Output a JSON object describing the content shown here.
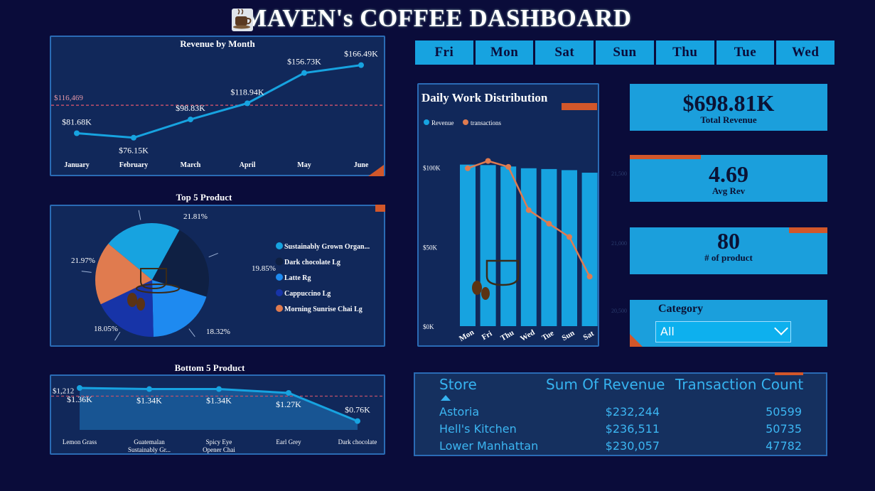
{
  "header": {
    "title": "MAVEN's COFFEE DASHBOARD"
  },
  "colors": {
    "background": "#0a0c3a",
    "panel": "#11285a",
    "accent_blue": "#17a3e0",
    "accent_orange": "#e07b4f",
    "pie_dark": "#0f2043",
    "pie_blue2": "#1e8af0",
    "pie_blue3": "#1734a8"
  },
  "day_buttons": [
    "Fri",
    "Mon",
    "Sat",
    "Sun",
    "Thu",
    "Tue",
    "Wed"
  ],
  "kpis": {
    "total_revenue": {
      "value": "$698.81K",
      "label": "Total Revenue"
    },
    "avg_rev": {
      "value": "4.69",
      "label": "Avg Rev"
    },
    "num_product": {
      "value": "80",
      "label": "# of product"
    }
  },
  "category_filter": {
    "label": "Category",
    "selected": "All"
  },
  "table": {
    "headers": [
      "Store",
      "Sum Of Revenue",
      "Transaction Count"
    ],
    "rows": [
      [
        "Astoria",
        "$232,244",
        "50599"
      ],
      [
        "Hell's Kitchen",
        "$236,511",
        "50735"
      ],
      [
        "Lower Manhattan",
        "$230,057",
        "47782"
      ]
    ]
  },
  "chart_data": [
    {
      "type": "line",
      "title": "Revenue by Month",
      "categories": [
        "January",
        "February",
        "March",
        "April",
        "May",
        "June"
      ],
      "values": [
        81680,
        76150,
        98830,
        118940,
        156730,
        166490
      ],
      "data_labels": [
        "$81.68K",
        "$76.15K",
        "$98.83K",
        "$118.94K",
        "$156.73K",
        "$166.49K"
      ],
      "reference_line": {
        "value": 116469,
        "label": "$116,469"
      },
      "ylim": [
        60000,
        175000
      ]
    },
    {
      "type": "pie",
      "title": "Top 5 Product",
      "series": [
        {
          "name": "Sustainably Grown Organ...",
          "value": 21.97,
          "label": "21.97%",
          "color": "#17a3e0"
        },
        {
          "name": "Dark chocolate Lg",
          "value": 21.81,
          "label": "21.81%",
          "color": "#0f2043"
        },
        {
          "name": "Latte Rg",
          "value": 19.85,
          "label": "19.85%",
          "color": "#1e8af0"
        },
        {
          "name": "Cappuccino Lg",
          "value": 18.32,
          "label": "18.32%",
          "color": "#1734a8"
        },
        {
          "name": "Morning Sunrise Chai Lg",
          "value": 18.05,
          "label": "18.05%",
          "color": "#e07b4f"
        }
      ]
    },
    {
      "type": "area",
      "title": "Bottom 5 Product",
      "categories": [
        "Lemon Grass",
        "Guatemalan Sustainably Gr...",
        "Spicy Eye Opener Chai",
        "Earl Grey",
        "Dark chocolate"
      ],
      "category_lines": [
        [
          "Lemon Grass"
        ],
        [
          "Guatemalan",
          "Sustainably Gr..."
        ],
        [
          "Spicy Eye",
          "Opener Chai"
        ],
        [
          "Earl Grey"
        ],
        [
          "Dark chocolate"
        ]
      ],
      "values": [
        1360,
        1340,
        1340,
        1270,
        760
      ],
      "data_labels": [
        "$1.36K",
        "$1.34K",
        "$1.34K",
        "$1.27K",
        "$0.76K"
      ],
      "reference_line": {
        "value": 1212,
        "label": "$1,212"
      },
      "ylim": [
        600,
        1450
      ]
    },
    {
      "type": "bar",
      "title": "Daily Work Distribution",
      "categories": [
        "Mon",
        "Fri",
        "Thu",
        "Wed",
        "Tue",
        "Sun",
        "Sat"
      ],
      "series": [
        {
          "name": "Revenue",
          "kind": "bar",
          "color": "#17a3e0",
          "values": [
            101800,
            101500,
            100600,
            99500,
            99000,
            98300,
            96700
          ]
        },
        {
          "name": "transactions",
          "kind": "line",
          "color": "#e07b4f",
          "values": [
            21643,
            21701,
            21654,
            21310,
            21202,
            21096,
            20781
          ]
        }
      ],
      "y_ticks": [
        "$0K",
        "$50K",
        "$100K"
      ],
      "ylim": [
        0,
        120000
      ],
      "y2lim": [
        20500,
        21800
      ],
      "y2_ticks": [
        "21,500",
        "21,000",
        "20,500"
      ],
      "legend_position": "top-left"
    }
  ]
}
